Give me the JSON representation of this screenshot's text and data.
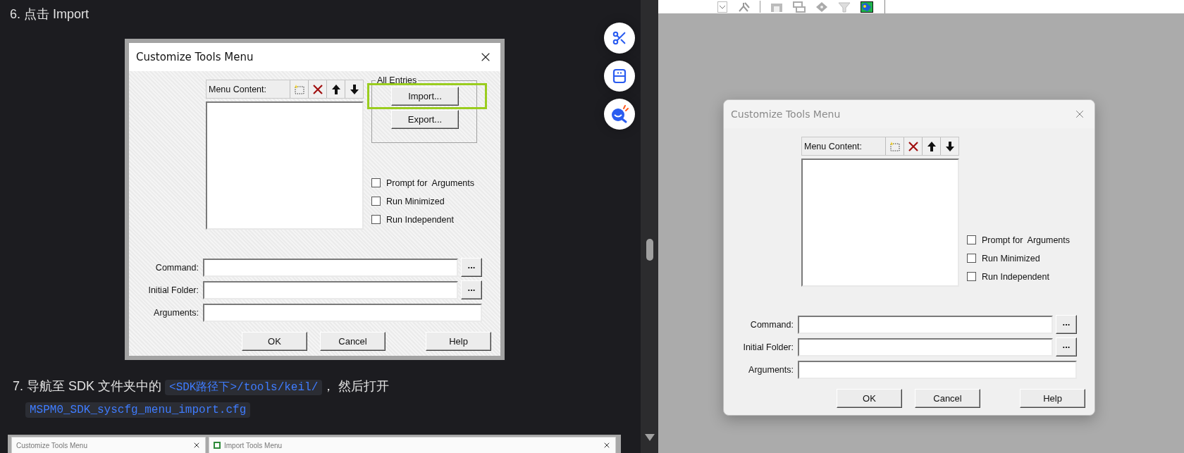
{
  "article": {
    "step_6": {
      "text": "6. 点击 Import"
    },
    "screenshot_dialog": {
      "kind": "classic",
      "title": "Customize Tools Menu",
      "menu_content": {
        "label": "Menu Content:"
      },
      "all_entries": {
        "label": "All Entries",
        "buttons": [
          {
            "label": "Import...",
            "highlighted": true
          },
          {
            "label": "Export...",
            "highlighted": false
          }
        ]
      },
      "options": [
        {
          "label": "Prompt for  Arguments",
          "checked": false
        },
        {
          "label": "Run Minimized",
          "checked": false
        },
        {
          "label": "Run Independent",
          "checked": false
        }
      ],
      "fields": [
        {
          "label": "Command:",
          "browse": "..."
        },
        {
          "label": "Initial Folder:",
          "browse": "..."
        },
        {
          "label": "Arguments:"
        }
      ],
      "buttons": [
        "OK",
        "Cancel",
        "Help"
      ]
    },
    "step_7": {
      "parts": [
        {
          "kind": "text",
          "text": "7. 导航至 SDK 文件夹中的 "
        },
        {
          "kind": "code",
          "text": "<SDK路径下>/tools/keil/"
        },
        {
          "kind": "text",
          "text": "， 然后打开 "
        },
        {
          "kind": "code",
          "text": "MSPM0_SDK_syscfg_menu_import.cfg"
        }
      ]
    },
    "screenshot_strip": {
      "windows": [
        {
          "kind": "plain",
          "title": "Customize Tools Menu"
        },
        {
          "kind": "app",
          "title": "Import Tools Menu"
        }
      ]
    }
  },
  "floating_buttons": [
    {
      "kind": "scissors"
    },
    {
      "kind": "panel"
    },
    {
      "kind": "assistant"
    }
  ],
  "right_pane": {
    "dialog": {
      "kind": "modern",
      "title": "Customize Tools Menu",
      "menu_content": {
        "label": "Menu Content:"
      },
      "options": [
        {
          "label": "Prompt for  Arguments",
          "checked": false
        },
        {
          "label": "Run Minimized",
          "checked": false
        },
        {
          "label": "Run Independent",
          "checked": false
        }
      ],
      "fields": [
        {
          "label": "Command:",
          "browse": "..."
        },
        {
          "label": "Initial Folder:",
          "browse": "..."
        },
        {
          "label": "Arguments:"
        }
      ],
      "buttons": [
        "OK",
        "Cancel",
        "Help"
      ]
    }
  }
}
